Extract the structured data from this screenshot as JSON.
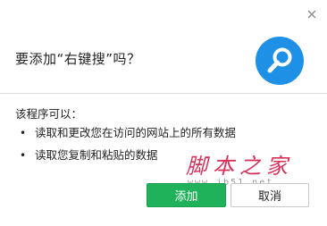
{
  "dialog": {
    "title": "要添加“右键搜”吗？",
    "permissions_heading": "该程序可以：",
    "permissions": [
      "读取和更改您在访问的网站上的所有数据",
      "读取您复制和粘贴的数据"
    ],
    "bullet": "•",
    "add_label": "添加",
    "cancel_label": "取消"
  },
  "watermark": {
    "text": "脚本之家",
    "url": "www.jb51.net"
  },
  "icons": {
    "close": "close-icon",
    "extension": "search-magnifier-icon"
  },
  "colors": {
    "accent_green": "#1fb25a",
    "icon_blue": "#1e90e6",
    "watermark_red": "#d9305a"
  }
}
